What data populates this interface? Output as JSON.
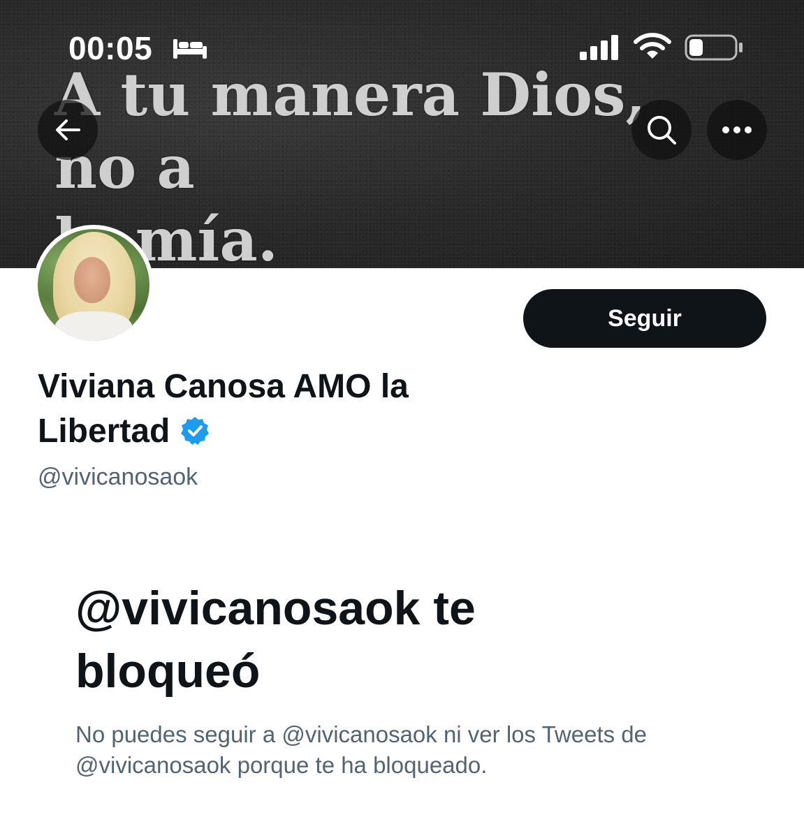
{
  "status_bar": {
    "time": "00:05",
    "icons": [
      "bed-icon",
      "signal-icon",
      "wifi-icon",
      "battery-icon"
    ],
    "battery_level": 0.3
  },
  "banner": {
    "quote_line1": "A tu manera Dios, no a",
    "quote_line2": "la mía."
  },
  "nav": {
    "back_icon": "arrow-left-icon",
    "search_icon": "search-icon",
    "more_icon": "more-icon"
  },
  "profile": {
    "display_name_line1": "Viviana Canosa AMO la",
    "display_name_line2": "Libertad",
    "handle": "@vivicanosaok",
    "verified": true,
    "follow_label": "Seguir"
  },
  "blocked": {
    "title_line1": "@vivicanosaok te",
    "title_line2": "bloqueó",
    "desc_line1": "No puedes seguir a @vivicanosaok ni ver los Tweets de",
    "desc_line2": "@vivicanosaok porque te ha bloqueado."
  },
  "colors": {
    "primary_text": "#0f1419",
    "secondary_text": "#536471",
    "verified_blue": "#1d9bf0",
    "button_bg": "#0f1419"
  }
}
